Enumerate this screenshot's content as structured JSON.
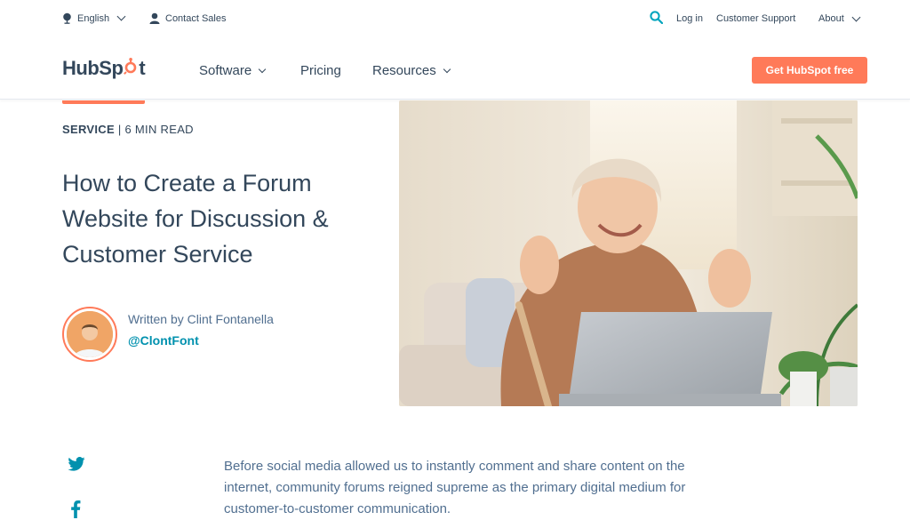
{
  "utility": {
    "language": "English",
    "contact_sales": "Contact Sales",
    "login": "Log in",
    "customer_support": "Customer Support",
    "about": "About"
  },
  "nav": {
    "logo_text_a": "HubSp",
    "logo_text_b": "t",
    "software": "Software",
    "pricing": "Pricing",
    "resources": "Resources",
    "cta": "Get HubSpot free"
  },
  "article": {
    "category": "SERVICE",
    "separator": "|",
    "read_time": "6 MIN READ",
    "title": "How to Create a Forum Website for Discussion & Customer Service",
    "written_by": "Written by Clint Fontanella",
    "handle": "@ClontFont",
    "intro": "Before social media allowed us to instantly comment and share content on the internet, community forums reigned supreme as the primary digital medium for customer-to-customer communication."
  },
  "icons": {
    "globe": "globe-icon",
    "person": "person-icon",
    "search": "search-icon",
    "twitter": "twitter-icon",
    "facebook": "facebook-icon"
  },
  "colors": {
    "accent": "#ff7a59",
    "text": "#33475b",
    "link": "#0091ae",
    "search_icon": "#00a4bd"
  }
}
